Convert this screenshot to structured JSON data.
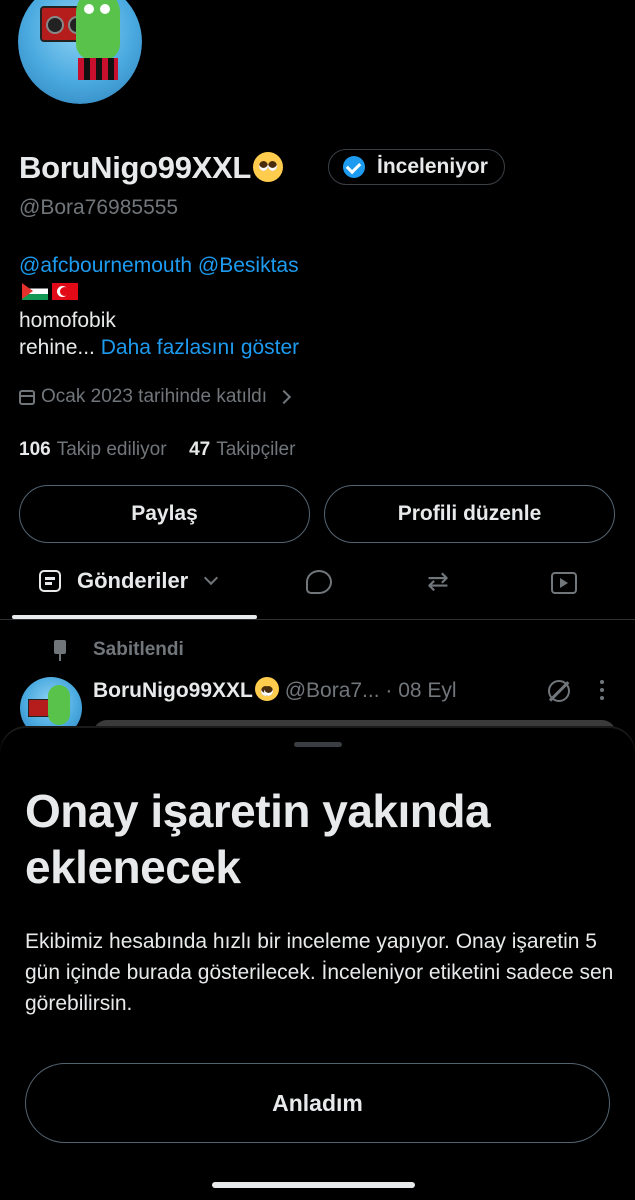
{
  "profile": {
    "name": "BoruNigo99XXL",
    "badge_label": "İnceleniyor",
    "handle": "@Bora76985555",
    "bio_mentions": "@afcbournemouth @Besiktas",
    "bio_line1": "homofobik",
    "bio_line2": "rehine...",
    "show_more": "Daha fazlasını göster",
    "joined": "Ocak 2023 tarihinde katıldı",
    "following_count": "106",
    "following_label": "Takip ediliyor",
    "followers_count": "47",
    "followers_label": "Takipçiler",
    "share_button": "Paylaş",
    "edit_button": "Profili düzenle"
  },
  "tabs": {
    "posts_label": "Gönderiler"
  },
  "post": {
    "pinned_label": "Sabitlendi",
    "author_name": "BoruNigo99XXL",
    "author_handle": "@Bora7...",
    "date": "· 08 Eyl"
  },
  "sheet": {
    "title": "Onay işaretin yakında eklenecek",
    "body": "Ekibimiz hesabında hızlı bir inceleme yapıyor. Onay işaretin 5 gün içinde burada gösterilecek. İnceleniyor etiketini sadece sen görebilirsin.",
    "confirm_button": "Anladım"
  },
  "colors": {
    "background": "#000000",
    "text": "#e7e9ea",
    "secondary_text": "#71767b",
    "accent": "#1d9bf0",
    "border": "#536471"
  }
}
